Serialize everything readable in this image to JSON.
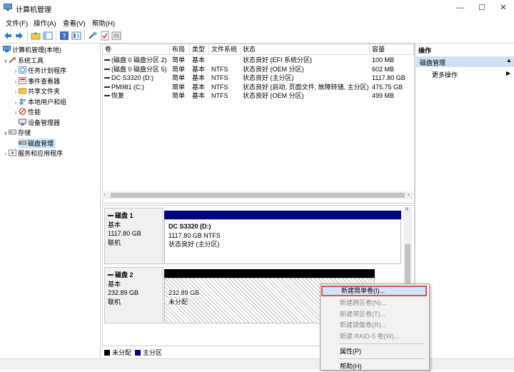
{
  "window": {
    "title": "计算机管理",
    "minimize_icon": "minimize-icon",
    "maximize_icon": "maximize-icon",
    "close_icon": "close-icon"
  },
  "menu": [
    "文件(F)",
    "操作(A)",
    "查看(V)",
    "帮助(H)"
  ],
  "toolbar": {
    "icons": [
      "back-arrow-icon",
      "forward-arrow-icon",
      "up-folder-icon",
      "show-hide-tree-icon",
      "help-icon",
      "properties-icon",
      "connect-icon",
      "check-icon",
      "list-icon"
    ]
  },
  "tree": {
    "root": "计算机管理(本地)",
    "system_tools": "系统工具",
    "task_scheduler": "任务计划程序",
    "event_viewer": "事件查看器",
    "shared_folders": "共享文件夹",
    "local_users": "本地用户和组",
    "performance": "性能",
    "device_manager": "设备管理器",
    "storage": "存储",
    "disk_management": "磁盘管理",
    "services_apps": "服务和应用程序"
  },
  "volume_table": {
    "headers": [
      "卷",
      "布局",
      "类型",
      "文件系统",
      "状态",
      "容量"
    ],
    "rows": [
      [
        "(磁盘 0 磁盘分区 2)",
        "简单",
        "基本",
        "",
        "状态良好 (EFI 系统分区)",
        "100 MB"
      ],
      [
        "(磁盘 0 磁盘分区 5)",
        "简单",
        "基本",
        "NTFS",
        "状态良好 (OEM 分区)",
        "602 MB"
      ],
      [
        "DC S3320 (D:)",
        "简单",
        "基本",
        "NTFS",
        "状态良好 (主分区)",
        "1117.80 GB"
      ],
      [
        "PM981 (C:)",
        "简单",
        "基本",
        "NTFS",
        "状态良好 (启动, 页面文件, 故障转储, 主分区)",
        "475.75 GB"
      ],
      [
        "恢复",
        "简单",
        "基本",
        "NTFS",
        "状态良好 (OEM 分区)",
        "499 MB"
      ]
    ]
  },
  "disks": [
    {
      "name": "磁盘 1",
      "type": "基本",
      "size": "1117.80 GB",
      "status": "联机",
      "volume": {
        "title": "DC S3320  (D:)",
        "size": "1117.80 GB NTFS",
        "status": "状态良好 (主分区)"
      }
    },
    {
      "name": "磁盘 2",
      "type": "基本",
      "size": "232.89 GB",
      "status": "联机",
      "volume": {
        "size": "232.89 GB",
        "status": "未分配"
      }
    }
  ],
  "legend": {
    "unallocated": "未分配",
    "primary": "主分区"
  },
  "colors": {
    "primary_partition": "#00007f",
    "unallocated": "#000000",
    "selection": "#cce8ff",
    "highlight_border": "#d9534f",
    "actions_header": "#cfe0f0"
  },
  "actions": {
    "header": "操作",
    "section": "磁盘管理",
    "more": "更多操作"
  },
  "context_menu": {
    "items": [
      {
        "label": "新建简单卷(I)...",
        "enabled": true
      },
      {
        "label": "新建跨区卷(N)...",
        "enabled": false
      },
      {
        "label": "新建带区卷(T)...",
        "enabled": false
      },
      {
        "label": "新建镜像卷(R)...",
        "enabled": false
      },
      {
        "label": "新建 RAID-5 卷(W)...",
        "enabled": false
      },
      {
        "label": "属性(P)",
        "enabled": true
      },
      {
        "label": "帮助(H)",
        "enabled": true
      }
    ]
  }
}
